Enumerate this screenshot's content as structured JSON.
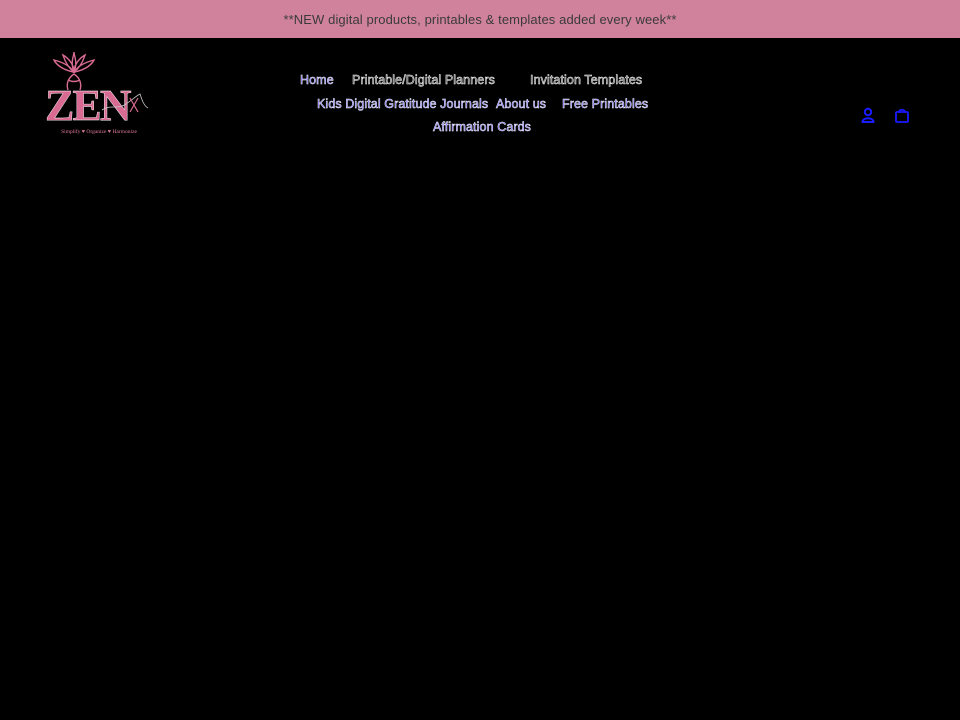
{
  "announcement": {
    "text": "**NEW digital products, printables & templates added every week**"
  },
  "logo": {
    "wordmark": "ZEN",
    "tagline": "Simplify ♥ Organize ♥ Harmonize",
    "color": "#d96b93"
  },
  "nav": {
    "items": [
      {
        "label": "Home"
      },
      {
        "label": "Printable/Digital Planners"
      },
      {
        "label": "Invitation Templates"
      },
      {
        "label": "Kids Digital Gratitude Journals"
      },
      {
        "label": "About us"
      },
      {
        "label": "Free Printables"
      },
      {
        "label": "Affirmation Cards"
      }
    ]
  },
  "icons": {
    "account": "account-icon",
    "cart": "cart-icon"
  },
  "colors": {
    "announcement_bg": "#d0829c",
    "page_bg": "#000000",
    "link_blue": "#5b4cf0",
    "icon_blue": "#1a1aff"
  }
}
